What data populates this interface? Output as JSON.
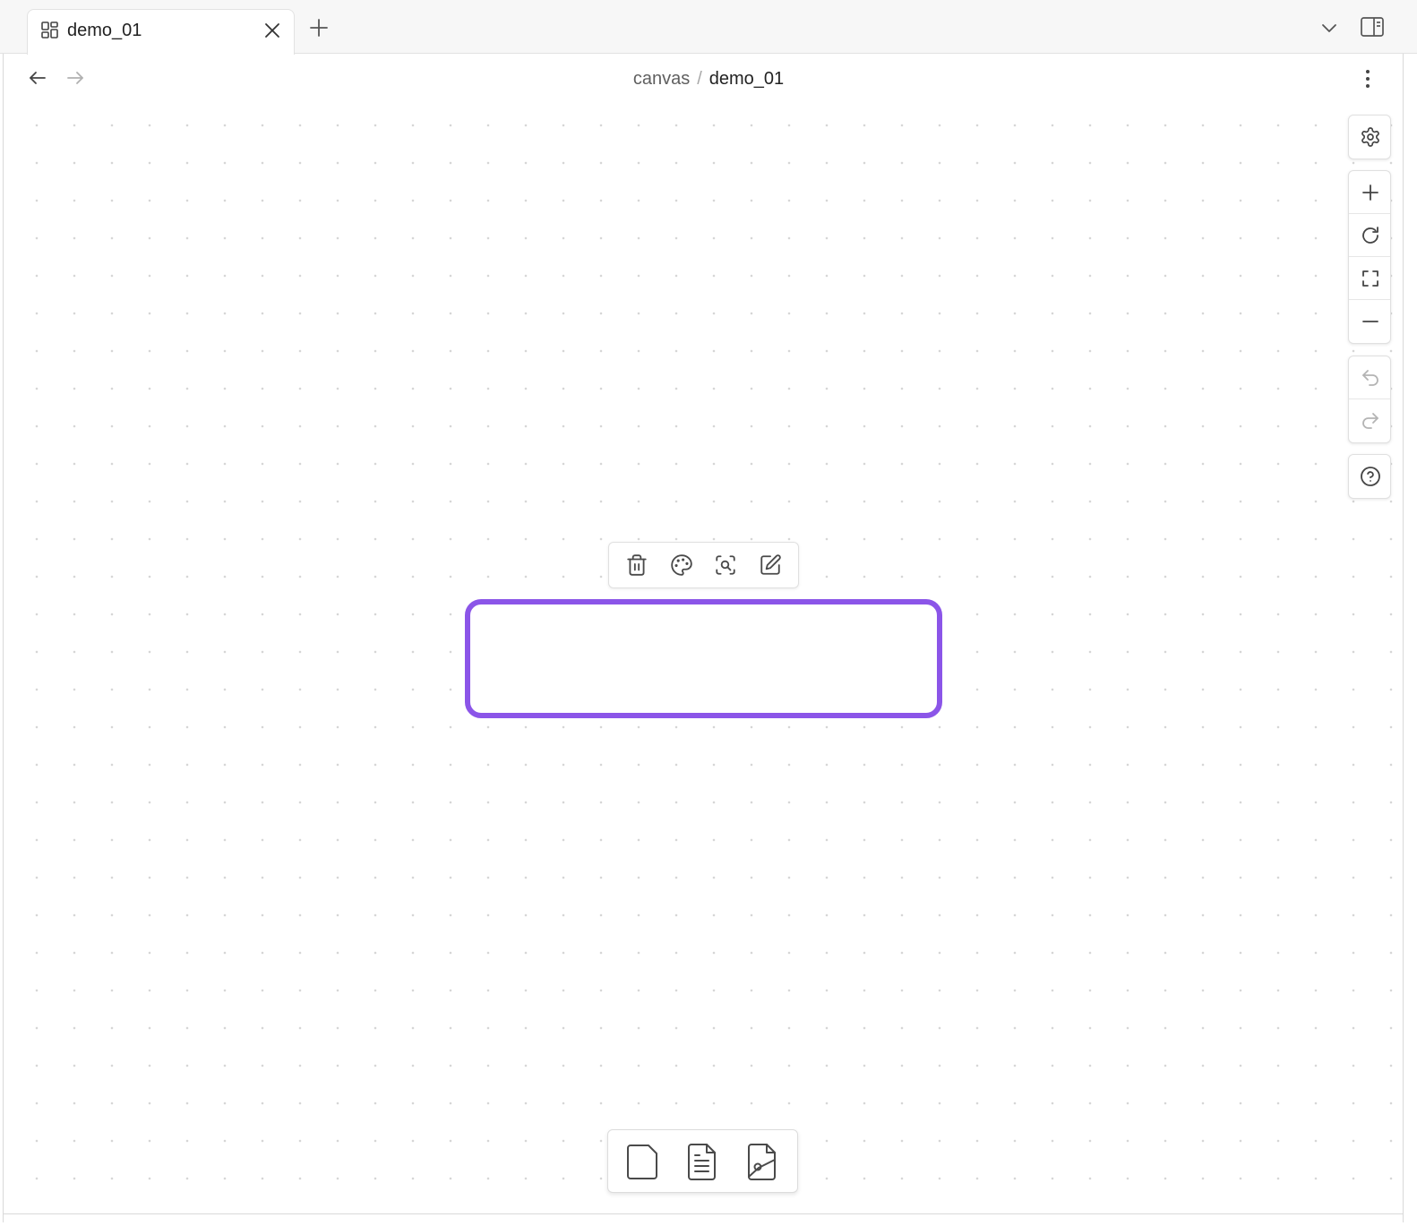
{
  "tabs": [
    {
      "title": "demo_01",
      "icon": "canvas-layout-icon",
      "active": true
    }
  ],
  "tab_actions": {
    "new_tab_icon": "plus-icon",
    "tab_list_icon": "chevron-down-icon",
    "sidebar_toggle_icon": "right-sidebar-icon"
  },
  "navigation": {
    "back_icon": "arrow-left-icon",
    "forward_icon": "arrow-right-icon",
    "more_icon": "more-vertical-icon"
  },
  "breadcrumb": {
    "parent": "canvas",
    "separator": "/",
    "current": "demo_01"
  },
  "canvas_controls": {
    "settings": "gear-icon",
    "zoom": [
      "plus-icon",
      "reset-zoom-icon",
      "zoom-to-fit-icon",
      "minus-icon"
    ],
    "history": [
      "undo-icon",
      "redo-icon"
    ],
    "help": "help-icon"
  },
  "node_menu": [
    "trash-icon",
    "palette-icon",
    "zoom-to-selection-icon",
    "edit-icon"
  ],
  "card_menu": [
    "new-card-icon",
    "add-note-icon",
    "add-media-icon"
  ],
  "colors": {
    "selection": "#8b55e8",
    "icon": "#4a4a4a",
    "icon_disabled": "#b4b4b4",
    "grid_dot": "#d6d6d6"
  }
}
